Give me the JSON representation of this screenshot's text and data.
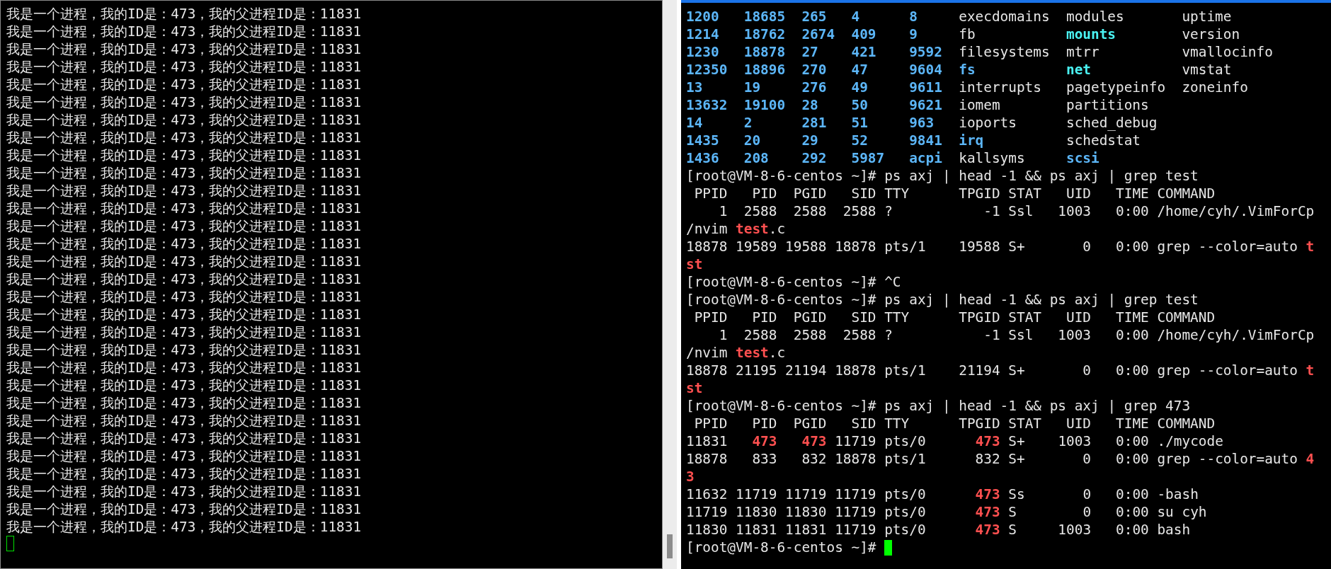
{
  "left_terminal": {
    "focused": false,
    "lines": [
      "我是一个进程，我的ID是：473，我的父进程ID是：11831",
      "我是一个进程，我的ID是：473，我的父进程ID是：11831",
      "我是一个进程，我的ID是：473，我的父进程ID是：11831",
      "我是一个进程，我的ID是：473，我的父进程ID是：11831",
      "我是一个进程，我的ID是：473，我的父进程ID是：11831",
      "我是一个进程，我的ID是：473，我的父进程ID是：11831",
      "我是一个进程，我的ID是：473，我的父进程ID是：11831",
      "我是一个进程，我的ID是：473，我的父进程ID是：11831",
      "我是一个进程，我的ID是：473，我的父进程ID是：11831",
      "我是一个进程，我的ID是：473，我的父进程ID是：11831",
      "我是一个进程，我的ID是：473，我的父进程ID是：11831",
      "我是一个进程，我的ID是：473，我的父进程ID是：11831",
      "我是一个进程，我的ID是：473，我的父进程ID是：11831",
      "我是一个进程，我的ID是：473，我的父进程ID是：11831",
      "我是一个进程，我的ID是：473，我的父进程ID是：11831",
      "我是一个进程，我的ID是：473，我的父进程ID是：11831",
      "我是一个进程，我的ID是：473，我的父进程ID是：11831",
      "我是一个进程，我的ID是：473，我的父进程ID是：11831",
      "我是一个进程，我的ID是：473，我的父进程ID是：11831",
      "我是一个进程，我的ID是：473，我的父进程ID是：11831",
      "我是一个进程，我的ID是：473，我的父进程ID是：11831",
      "我是一个进程，我的ID是：473，我的父进程ID是：11831",
      "我是一个进程，我的ID是：473，我的父进程ID是：11831",
      "我是一个进程，我的ID是：473，我的父进程ID是：11831",
      "我是一个进程，我的ID是：473，我的父进程ID是：11831",
      "我是一个进程，我的ID是：473，我的父进程ID是：11831",
      "我是一个进程，我的ID是：473，我的父进程ID是：11831",
      "我是一个进程，我的ID是：473，我的父进程ID是：11831",
      "我是一个进程，我的ID是：473，我的父进程ID是：11831",
      "我是一个进程，我的ID是：473，我的父进程ID是：11831"
    ]
  },
  "right_terminal": {
    "focused": true,
    "lines": [
      {
        "kind": "ls",
        "cells": [
          {
            "text": "1200",
            "kind": "dir"
          },
          {
            "text": "18685",
            "kind": "dir"
          },
          {
            "text": "265",
            "kind": "dir"
          },
          {
            "text": "4",
            "kind": "dir"
          },
          {
            "text": "8",
            "kind": "dir"
          },
          {
            "text": "execdomains",
            "kind": "file"
          },
          {
            "text": "modules",
            "kind": "file"
          },
          {
            "text": "uptime",
            "kind": "file"
          }
        ]
      },
      {
        "kind": "ls",
        "cells": [
          {
            "text": "1214",
            "kind": "dir"
          },
          {
            "text": "18762",
            "kind": "dir"
          },
          {
            "text": "2674",
            "kind": "dir"
          },
          {
            "text": "409",
            "kind": "dir"
          },
          {
            "text": "9",
            "kind": "dir"
          },
          {
            "text": "fb",
            "kind": "file"
          },
          {
            "text": "mounts",
            "kind": "link"
          },
          {
            "text": "version",
            "kind": "file"
          }
        ]
      },
      {
        "kind": "ls",
        "cells": [
          {
            "text": "1230",
            "kind": "dir"
          },
          {
            "text": "18878",
            "kind": "dir"
          },
          {
            "text": "27",
            "kind": "dir"
          },
          {
            "text": "421",
            "kind": "dir"
          },
          {
            "text": "9592",
            "kind": "dir"
          },
          {
            "text": "filesystems",
            "kind": "file"
          },
          {
            "text": "mtrr",
            "kind": "file"
          },
          {
            "text": "vmallocinfo",
            "kind": "file"
          }
        ]
      },
      {
        "kind": "ls",
        "cells": [
          {
            "text": "12350",
            "kind": "dir"
          },
          {
            "text": "18896",
            "kind": "dir"
          },
          {
            "text": "270",
            "kind": "dir"
          },
          {
            "text": "47",
            "kind": "dir"
          },
          {
            "text": "9604",
            "kind": "dir"
          },
          {
            "text": "fs",
            "kind": "dir"
          },
          {
            "text": "net",
            "kind": "link"
          },
          {
            "text": "vmstat",
            "kind": "file"
          }
        ]
      },
      {
        "kind": "ls",
        "cells": [
          {
            "text": "13",
            "kind": "dir"
          },
          {
            "text": "19",
            "kind": "dir"
          },
          {
            "text": "276",
            "kind": "dir"
          },
          {
            "text": "49",
            "kind": "dir"
          },
          {
            "text": "9611",
            "kind": "dir"
          },
          {
            "text": "interrupts",
            "kind": "file"
          },
          {
            "text": "pagetypeinfo",
            "kind": "file"
          },
          {
            "text": "zoneinfo",
            "kind": "file"
          }
        ]
      },
      {
        "kind": "ls",
        "cells": [
          {
            "text": "13632",
            "kind": "dir"
          },
          {
            "text": "19100",
            "kind": "dir"
          },
          {
            "text": "28",
            "kind": "dir"
          },
          {
            "text": "50",
            "kind": "dir"
          },
          {
            "text": "9621",
            "kind": "dir"
          },
          {
            "text": "iomem",
            "kind": "file"
          },
          {
            "text": "partitions",
            "kind": "file"
          }
        ]
      },
      {
        "kind": "ls",
        "cells": [
          {
            "text": "14",
            "kind": "dir"
          },
          {
            "text": "2",
            "kind": "dir"
          },
          {
            "text": "281",
            "kind": "dir"
          },
          {
            "text": "51",
            "kind": "dir"
          },
          {
            "text": "963",
            "kind": "dir"
          },
          {
            "text": "ioports",
            "kind": "file"
          },
          {
            "text": "sched_debug",
            "kind": "file"
          }
        ]
      },
      {
        "kind": "ls",
        "cells": [
          {
            "text": "1435",
            "kind": "dir"
          },
          {
            "text": "20",
            "kind": "dir"
          },
          {
            "text": "29",
            "kind": "dir"
          },
          {
            "text": "52",
            "kind": "dir"
          },
          {
            "text": "9841",
            "kind": "dir"
          },
          {
            "text": "irq",
            "kind": "dir"
          },
          {
            "text": "schedstat",
            "kind": "file"
          }
        ]
      },
      {
        "kind": "ls",
        "cells": [
          {
            "text": "1436",
            "kind": "dir"
          },
          {
            "text": "208",
            "kind": "dir"
          },
          {
            "text": "292",
            "kind": "dir"
          },
          {
            "text": "5987",
            "kind": "dir"
          },
          {
            "text": "acpi",
            "kind": "dir"
          },
          {
            "text": "kallsyms",
            "kind": "file"
          },
          {
            "text": "scsi",
            "kind": "dir"
          }
        ]
      },
      {
        "kind": "text",
        "segments": [
          {
            "text": "[root@VM-8-6-centos ~]# ps axj | head -1 && ps axj | grep test",
            "kind": "plain"
          }
        ]
      },
      {
        "kind": "text",
        "segments": [
          {
            "text": " PPID   PID  PGID   SID TTY      TPGID STAT   UID   TIME COMMAND",
            "kind": "plain"
          }
        ]
      },
      {
        "kind": "text",
        "segments": [
          {
            "text": "    1  2588  2588  2588 ?           -1 Ssl   1003   0:00 /home/cyh/.VimForCp",
            "kind": "plain"
          }
        ]
      },
      {
        "kind": "text",
        "segments": [
          {
            "text": "/nvim ",
            "kind": "plain"
          },
          {
            "text": "test",
            "kind": "match"
          },
          {
            "text": ".c",
            "kind": "plain"
          }
        ]
      },
      {
        "kind": "text",
        "segments": [
          {
            "text": "18878 19589 19588 18878 pts/1    19588 S+       0   0:00 grep --color=auto ",
            "kind": "plain"
          },
          {
            "text": "t",
            "kind": "match"
          }
        ]
      },
      {
        "kind": "text",
        "segments": [
          {
            "text": "st",
            "kind": "match"
          }
        ]
      },
      {
        "kind": "text",
        "segments": [
          {
            "text": "[root@VM-8-6-centos ~]# ^C",
            "kind": "plain"
          }
        ]
      },
      {
        "kind": "text",
        "segments": [
          {
            "text": "[root@VM-8-6-centos ~]# ps axj | head -1 && ps axj | grep test",
            "kind": "plain"
          }
        ]
      },
      {
        "kind": "text",
        "segments": [
          {
            "text": " PPID   PID  PGID   SID TTY      TPGID STAT   UID   TIME COMMAND",
            "kind": "plain"
          }
        ]
      },
      {
        "kind": "text",
        "segments": [
          {
            "text": "    1  2588  2588  2588 ?           -1 Ssl   1003   0:00 /home/cyh/.VimForCp",
            "kind": "plain"
          }
        ]
      },
      {
        "kind": "text",
        "segments": [
          {
            "text": "/nvim ",
            "kind": "plain"
          },
          {
            "text": "test",
            "kind": "match"
          },
          {
            "text": ".c",
            "kind": "plain"
          }
        ]
      },
      {
        "kind": "text",
        "segments": [
          {
            "text": "18878 21195 21194 18878 pts/1    21194 S+       0   0:00 grep --color=auto ",
            "kind": "plain"
          },
          {
            "text": "t",
            "kind": "match"
          }
        ]
      },
      {
        "kind": "text",
        "segments": [
          {
            "text": "st",
            "kind": "match"
          }
        ]
      },
      {
        "kind": "text",
        "segments": [
          {
            "text": "[root@VM-8-6-centos ~]# ps axj | head -1 && ps axj | grep 473",
            "kind": "plain"
          }
        ]
      },
      {
        "kind": "text",
        "segments": [
          {
            "text": " PPID   PID  PGID   SID TTY      TPGID STAT   UID   TIME COMMAND",
            "kind": "plain"
          }
        ]
      },
      {
        "kind": "text",
        "segments": [
          {
            "text": "11831   ",
            "kind": "plain"
          },
          {
            "text": "473   473",
            "kind": "match"
          },
          {
            "text": " 11719 pts/0      ",
            "kind": "plain"
          },
          {
            "text": "473",
            "kind": "match"
          },
          {
            "text": " S+    1003   0:00 ./mycode",
            "kind": "plain"
          }
        ]
      },
      {
        "kind": "text",
        "segments": [
          {
            "text": "18878   833   832 18878 pts/1      832 S+       0   0:00 grep --color=auto ",
            "kind": "plain"
          },
          {
            "text": "4",
            "kind": "match"
          }
        ]
      },
      {
        "kind": "text",
        "segments": [
          {
            "text": "3",
            "kind": "match"
          }
        ]
      },
      {
        "kind": "text",
        "segments": [
          {
            "text": "11632 11719 11719 11719 pts/0      ",
            "kind": "plain"
          },
          {
            "text": "473",
            "kind": "match"
          },
          {
            "text": " Ss       0   0:00 -bash",
            "kind": "plain"
          }
        ]
      },
      {
        "kind": "text",
        "segments": [
          {
            "text": "11719 11830 11830 11719 pts/0      ",
            "kind": "plain"
          },
          {
            "text": "473",
            "kind": "match"
          },
          {
            "text": " S        0   0:00 su cyh",
            "kind": "plain"
          }
        ]
      },
      {
        "kind": "text",
        "segments": [
          {
            "text": "11830 11831 11831 11719 pts/0      ",
            "kind": "plain"
          },
          {
            "text": "473",
            "kind": "match"
          },
          {
            "text": " S     1003   0:00 bash",
            "kind": "plain"
          }
        ]
      },
      {
        "kind": "prompt",
        "segments": [
          {
            "text": "[root@VM-8-6-centos ~]# ",
            "kind": "plain"
          }
        ]
      }
    ]
  }
}
